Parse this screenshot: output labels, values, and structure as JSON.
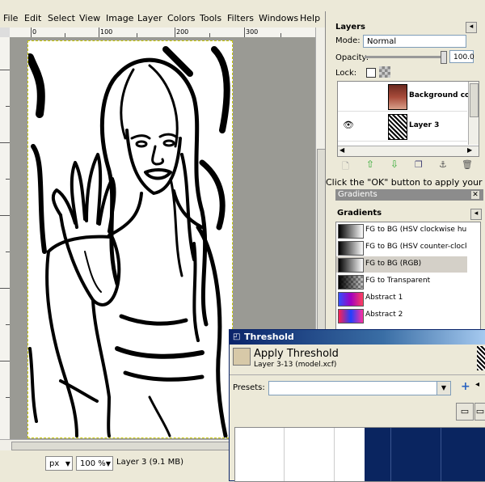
{
  "menu": [
    "File",
    "Edit",
    "Select",
    "View",
    "Image",
    "Layer",
    "Colors",
    "Tools",
    "Filters",
    "Windows",
    "Help"
  ],
  "ruler": {
    "marks": [
      "0",
      "100",
      "200",
      "300"
    ]
  },
  "status": {
    "unit": "px",
    "zoom": "100 %",
    "layer_info": "Layer 3 (9.1 MB)"
  },
  "layers_panel": {
    "title": "Layers",
    "mode_label": "Mode:",
    "mode_value": "Normal",
    "opacity_label": "Opacity:",
    "opacity_value": "100.0",
    "opacity_level": 1.0,
    "lock_label": "Lock:",
    "layers": [
      {
        "name": "Background cop"
      },
      {
        "name": "Layer 3"
      }
    ]
  },
  "behind_text": "Click the \"OK\" button to apply your",
  "gradients_panel": {
    "tab_title": "Gradients",
    "header": "Gradients",
    "items": [
      {
        "label": "FG to BG (HSV clockwise hue)",
        "selected": false
      },
      {
        "label": "FG to BG (HSV counter-clockwise",
        "selected": false
      },
      {
        "label": "FG to BG (RGB)",
        "selected": true
      },
      {
        "label": "FG to Transparent",
        "selected": false
      },
      {
        "label": "Abstract 1",
        "selected": false
      },
      {
        "label": "Abstract 2",
        "selected": false
      }
    ]
  },
  "threshold": {
    "title": "Threshold",
    "heading": "Apply Threshold",
    "subheading": "Layer 3-13 (model.xcf)",
    "presets_label": "Presets:",
    "presets_value": ""
  },
  "colors": {
    "title_bar": "#0a246a",
    "histogram_fill": "#0a2560",
    "selected_row": "#d4d0c8"
  }
}
